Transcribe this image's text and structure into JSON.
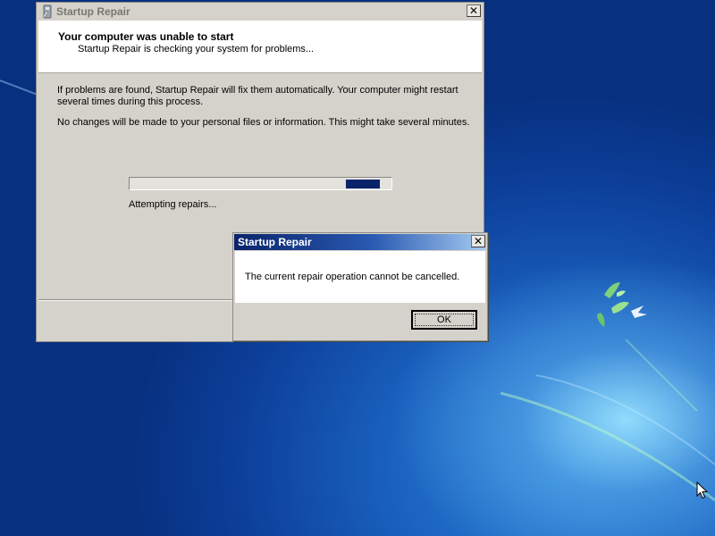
{
  "colors": {
    "desktop_blue": "#0b3a93",
    "dialog_titlebar": "#0a246a",
    "progress_fill": "#0a246a",
    "window_face": "#d5d2cb"
  },
  "main_window": {
    "title": "Startup Repair",
    "icon": "startup-repair-icon",
    "close_glyph": "✕",
    "header_title": "Your computer was unable to start",
    "header_subtitle": "Startup Repair is checking your system for problems...",
    "paragraph1": "If problems are found, Startup Repair will fix them automatically. Your computer might restart several times during this process.",
    "paragraph2": "No changes will be made to your personal files or information. This might take several minutes.",
    "progress": {
      "style": "marquee"
    },
    "status": "Attempting repairs..."
  },
  "dialog": {
    "title": "Startup Repair",
    "close_glyph": "✕",
    "message": "The current repair operation cannot be cancelled.",
    "ok_label": "OK"
  },
  "desktop": {
    "logo": "windows-fish-logo-icon",
    "cursor": "arrow-cursor-icon"
  }
}
